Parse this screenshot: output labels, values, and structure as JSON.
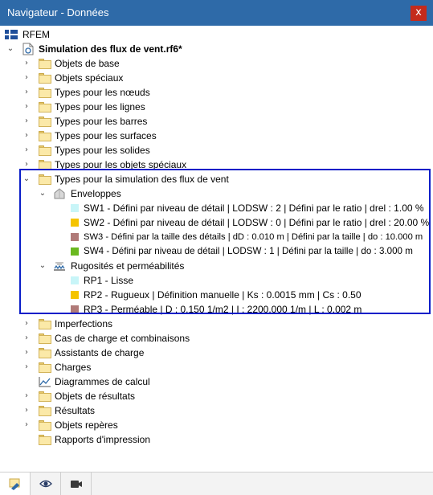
{
  "window": {
    "title": "Navigateur - Données",
    "close_glyph": "x"
  },
  "tree": {
    "root": "RFEM",
    "file": "Simulation des flux de vent.rf6*",
    "items_before": [
      "Objets de base",
      "Objets spéciaux",
      "Types pour les nœuds",
      "Types pour les lignes",
      "Types pour les barres",
      "Types pour les surfaces",
      "Types pour les solides",
      "Types pour les objets spéciaux"
    ],
    "wind": {
      "label": "Types pour la simulation des flux de vent",
      "envelopes": {
        "label": "Enveloppes",
        "items": [
          {
            "label": "SW1 - Défini par niveau de détail | LODSW : 2 | Défini par le ratio | drel : 1.00 %",
            "color": "#c8f5f8"
          },
          {
            "label": "SW2 - Défini par niveau de détail | LODSW : 0 | Défini par le ratio | drel : 20.00 %",
            "color": "#f5c400"
          },
          {
            "label": "SW3 - Défini par la taille des détails | dD : 0.010 m | Défini par la taille | do : 10.000 m",
            "color": "#b07a78"
          },
          {
            "label": "SW4 - Défini par niveau de détail | LODSW : 1 | Défini par la taille | do : 3.000 m",
            "color": "#6ab820"
          }
        ]
      },
      "roughness": {
        "label": "Rugosités et perméabilités",
        "items": [
          {
            "label": "RP1 - Lisse",
            "color": "#c8f5f8"
          },
          {
            "label": "RP2 - Rugueux | Définition manuelle | Ks : 0.0015 mm | Cs : 0.50",
            "color": "#f5c400"
          },
          {
            "label": "RP3 - Perméable | D : 0.150 1/m2 | I : 2200.000 1/m | L : 0.002 m",
            "color": "#b07a78"
          }
        ]
      }
    },
    "items_after": [
      {
        "label": "Imperfections",
        "expandable": true
      },
      {
        "label": "Cas de charge et combinaisons",
        "expandable": true
      },
      {
        "label": "Assistants de charge",
        "expandable": true
      },
      {
        "label": "Charges",
        "expandable": true
      },
      {
        "label": "Diagrammes de calcul",
        "expandable": false,
        "icon": "chart-icon"
      },
      {
        "label": "Objets de résultats",
        "expandable": true
      },
      {
        "label": "Résultats",
        "expandable": true
      },
      {
        "label": "Objets repères",
        "expandable": true
      },
      {
        "label": "Rapports d'impression",
        "expandable": false
      }
    ]
  },
  "bottom_tabs": [
    {
      "icon": "data-navigator-icon",
      "active": true
    },
    {
      "icon": "eye-icon",
      "active": false
    },
    {
      "icon": "camera-icon",
      "active": false
    }
  ]
}
